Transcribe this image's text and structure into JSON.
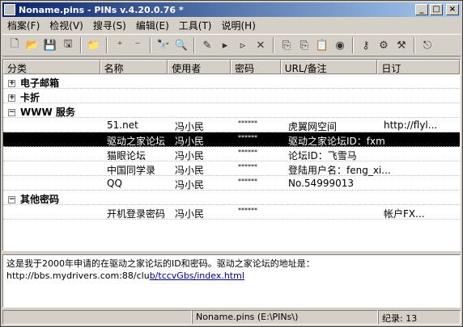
{
  "window": {
    "title": "Noname.pins - PINs v.4.20.0.76 *"
  },
  "menu": [
    "档案(F)",
    "检视(V)",
    "搜寻(S)",
    "编辑(E)",
    "工具(T)",
    "说明(H)"
  ],
  "toolbar": [
    "new-file-icon",
    "open-folder-icon",
    "save-icon",
    "save-as-icon",
    "open-icon",
    "add-entry-icon",
    "remove-entry-icon",
    "find-icon",
    "find-next-icon",
    "edit-icon",
    "add-item-icon",
    "add-sub-icon",
    "delete-icon",
    "copy-icon",
    "copy2-icon",
    "paste-icon",
    "web-icon",
    "key-icon",
    "password-gen-icon",
    "settings-icon",
    "exit-icon"
  ],
  "columns": [
    "分类",
    "名称",
    "使用者",
    "密码",
    "URL/备注",
    "日订"
  ],
  "rows": [
    {
      "type": "group",
      "label": "电子邮箱",
      "expander": "+"
    },
    {
      "type": "group",
      "label": "卡折",
      "expander": "+"
    },
    {
      "type": "group",
      "label": "WWW 服务",
      "expander": "−"
    },
    {
      "type": "item",
      "name": "51.net",
      "user": "冯小民",
      "pass": "******",
      "note": "虎翼网空间",
      "url": "http://flyl..."
    },
    {
      "type": "item",
      "name": "驱动之家论坛",
      "user": "冯小民",
      "pass": "******",
      "note": "驱动之家论坛ID：fxm",
      "url": "",
      "selected": true
    },
    {
      "type": "item",
      "name": "猫眼论坛",
      "user": "冯小民",
      "pass": "******",
      "note": "论坛ID：飞雪马",
      "url": ""
    },
    {
      "type": "item",
      "name": "中国同学录",
      "user": "冯小民",
      "pass": "******",
      "note": "登陆用户名：feng_xi...",
      "url": ""
    },
    {
      "type": "item",
      "name": "QQ",
      "user": "冯小民",
      "pass": "******",
      "note": "No.54999013",
      "url": ""
    },
    {
      "type": "group",
      "label": "其他密码",
      "expander": "−"
    },
    {
      "type": "item",
      "name": "开机登录密码",
      "user": "冯小民",
      "pass": "******",
      "note": "",
      "url": "帐户FX..."
    }
  ],
  "notes": {
    "line1": "这是我于2000年申请的在驱动之家论坛的ID和密码。驱动之家论坛的地址是：",
    "link_plain": "http://bbs.mydrivers.com:88/clu",
    "link_underlined": "b/tccvGbs/index.html"
  },
  "status": {
    "left": "",
    "file": "Noname.pins (E:\\PINs\\)",
    "records": "纪录: 13"
  }
}
